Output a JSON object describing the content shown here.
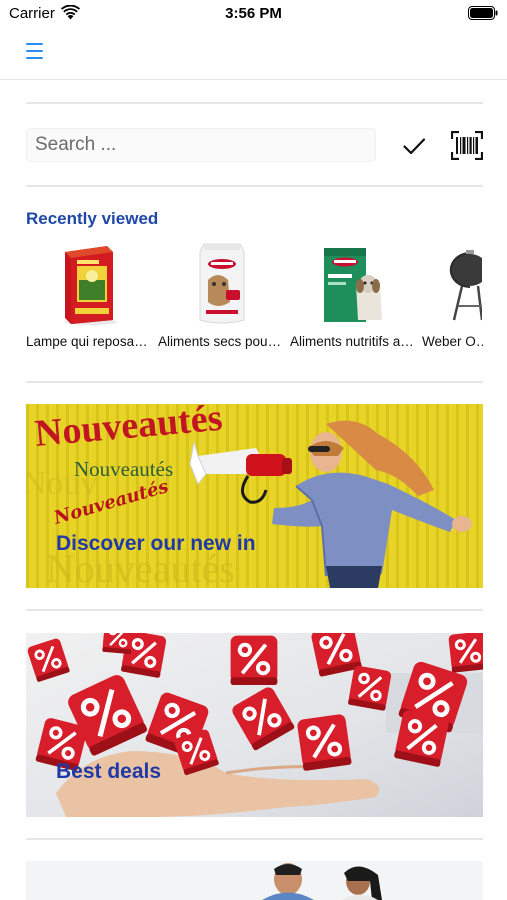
{
  "status_bar": {
    "carrier": "Carrier",
    "time": "3:56 PM"
  },
  "nav": {
    "menu_icon": "hamburger-menu-icon",
    "accent_color": "#2a8ef0"
  },
  "search": {
    "placeholder": "Search ...",
    "value": "",
    "confirm_icon": "checkmark-icon",
    "scan_icon": "barcode-scan-icon"
  },
  "recently_viewed": {
    "title": "Recently viewed",
    "title_color": "#1f47a8",
    "items": [
      {
        "label": "Lampe qui  reposant ..."
      },
      {
        "label": "Aliments secs pour chats"
      },
      {
        "label": "Aliments nutritifs adulte"
      },
      {
        "label": "Weber One Touch"
      }
    ]
  },
  "banners": [
    {
      "headline": "Nouveautés",
      "subtitle": "Nouveautés",
      "script": "Nouveautés",
      "caption": "Discover our new in"
    },
    {
      "caption": "Best deals"
    },
    {
      "caption": ""
    }
  ]
}
